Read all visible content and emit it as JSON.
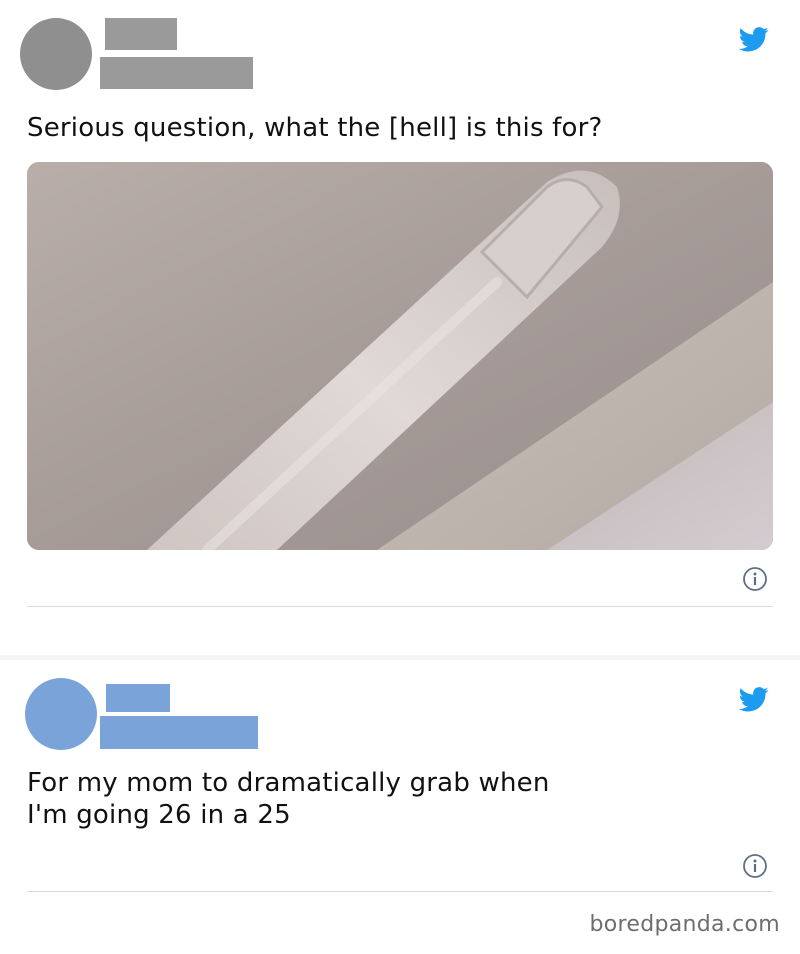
{
  "tweets": [
    {
      "text": "Serious question, what the [hell] is this for?",
      "icon": "twitter-bird-icon",
      "image_alt": "car ceiling grab handle",
      "redaction_color": "#9a9a9a"
    },
    {
      "text": "For my mom to dramatically grab when\nI'm going 26 in a 25",
      "icon": "twitter-bird-icon",
      "redaction_color": "#7aa4d9"
    }
  ],
  "colors": {
    "twitter_blue": "#1d9bf0",
    "rule": "#d4dde4"
  },
  "watermark": "boredpanda.com"
}
